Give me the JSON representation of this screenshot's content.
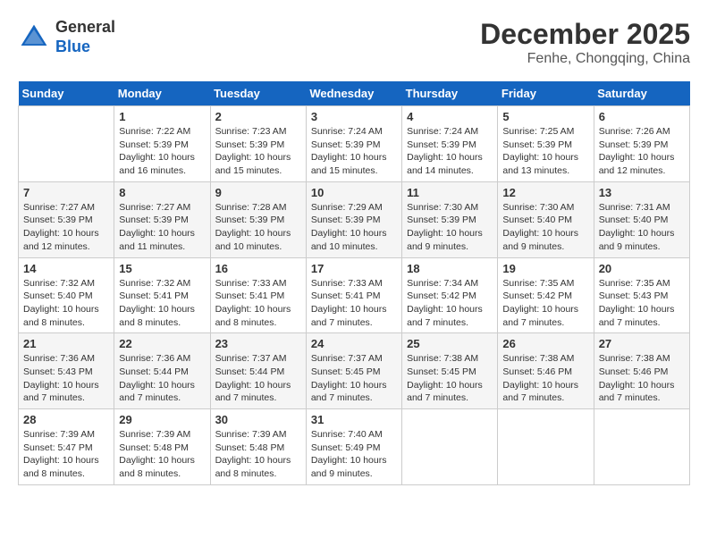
{
  "header": {
    "logo_general": "General",
    "logo_blue": "Blue",
    "month_year": "December 2025",
    "location": "Fenhe, Chongqing, China"
  },
  "days_of_week": [
    "Sunday",
    "Monday",
    "Tuesday",
    "Wednesday",
    "Thursday",
    "Friday",
    "Saturday"
  ],
  "weeks": [
    [
      {
        "day": "",
        "info": ""
      },
      {
        "day": "1",
        "info": "Sunrise: 7:22 AM\nSunset: 5:39 PM\nDaylight: 10 hours\nand 16 minutes."
      },
      {
        "day": "2",
        "info": "Sunrise: 7:23 AM\nSunset: 5:39 PM\nDaylight: 10 hours\nand 15 minutes."
      },
      {
        "day": "3",
        "info": "Sunrise: 7:24 AM\nSunset: 5:39 PM\nDaylight: 10 hours\nand 15 minutes."
      },
      {
        "day": "4",
        "info": "Sunrise: 7:24 AM\nSunset: 5:39 PM\nDaylight: 10 hours\nand 14 minutes."
      },
      {
        "day": "5",
        "info": "Sunrise: 7:25 AM\nSunset: 5:39 PM\nDaylight: 10 hours\nand 13 minutes."
      },
      {
        "day": "6",
        "info": "Sunrise: 7:26 AM\nSunset: 5:39 PM\nDaylight: 10 hours\nand 12 minutes."
      }
    ],
    [
      {
        "day": "7",
        "info": "Sunrise: 7:27 AM\nSunset: 5:39 PM\nDaylight: 10 hours\nand 12 minutes."
      },
      {
        "day": "8",
        "info": "Sunrise: 7:27 AM\nSunset: 5:39 PM\nDaylight: 10 hours\nand 11 minutes."
      },
      {
        "day": "9",
        "info": "Sunrise: 7:28 AM\nSunset: 5:39 PM\nDaylight: 10 hours\nand 10 minutes."
      },
      {
        "day": "10",
        "info": "Sunrise: 7:29 AM\nSunset: 5:39 PM\nDaylight: 10 hours\nand 10 minutes."
      },
      {
        "day": "11",
        "info": "Sunrise: 7:30 AM\nSunset: 5:39 PM\nDaylight: 10 hours\nand 9 minutes."
      },
      {
        "day": "12",
        "info": "Sunrise: 7:30 AM\nSunset: 5:40 PM\nDaylight: 10 hours\nand 9 minutes."
      },
      {
        "day": "13",
        "info": "Sunrise: 7:31 AM\nSunset: 5:40 PM\nDaylight: 10 hours\nand 9 minutes."
      }
    ],
    [
      {
        "day": "14",
        "info": "Sunrise: 7:32 AM\nSunset: 5:40 PM\nDaylight: 10 hours\nand 8 minutes."
      },
      {
        "day": "15",
        "info": "Sunrise: 7:32 AM\nSunset: 5:41 PM\nDaylight: 10 hours\nand 8 minutes."
      },
      {
        "day": "16",
        "info": "Sunrise: 7:33 AM\nSunset: 5:41 PM\nDaylight: 10 hours\nand 8 minutes."
      },
      {
        "day": "17",
        "info": "Sunrise: 7:33 AM\nSunset: 5:41 PM\nDaylight: 10 hours\nand 7 minutes."
      },
      {
        "day": "18",
        "info": "Sunrise: 7:34 AM\nSunset: 5:42 PM\nDaylight: 10 hours\nand 7 minutes."
      },
      {
        "day": "19",
        "info": "Sunrise: 7:35 AM\nSunset: 5:42 PM\nDaylight: 10 hours\nand 7 minutes."
      },
      {
        "day": "20",
        "info": "Sunrise: 7:35 AM\nSunset: 5:43 PM\nDaylight: 10 hours\nand 7 minutes."
      }
    ],
    [
      {
        "day": "21",
        "info": "Sunrise: 7:36 AM\nSunset: 5:43 PM\nDaylight: 10 hours\nand 7 minutes."
      },
      {
        "day": "22",
        "info": "Sunrise: 7:36 AM\nSunset: 5:44 PM\nDaylight: 10 hours\nand 7 minutes."
      },
      {
        "day": "23",
        "info": "Sunrise: 7:37 AM\nSunset: 5:44 PM\nDaylight: 10 hours\nand 7 minutes."
      },
      {
        "day": "24",
        "info": "Sunrise: 7:37 AM\nSunset: 5:45 PM\nDaylight: 10 hours\nand 7 minutes."
      },
      {
        "day": "25",
        "info": "Sunrise: 7:38 AM\nSunset: 5:45 PM\nDaylight: 10 hours\nand 7 minutes."
      },
      {
        "day": "26",
        "info": "Sunrise: 7:38 AM\nSunset: 5:46 PM\nDaylight: 10 hours\nand 7 minutes."
      },
      {
        "day": "27",
        "info": "Sunrise: 7:38 AM\nSunset: 5:46 PM\nDaylight: 10 hours\nand 7 minutes."
      }
    ],
    [
      {
        "day": "28",
        "info": "Sunrise: 7:39 AM\nSunset: 5:47 PM\nDaylight: 10 hours\nand 8 minutes."
      },
      {
        "day": "29",
        "info": "Sunrise: 7:39 AM\nSunset: 5:48 PM\nDaylight: 10 hours\nand 8 minutes."
      },
      {
        "day": "30",
        "info": "Sunrise: 7:39 AM\nSunset: 5:48 PM\nDaylight: 10 hours\nand 8 minutes."
      },
      {
        "day": "31",
        "info": "Sunrise: 7:40 AM\nSunset: 5:49 PM\nDaylight: 10 hours\nand 9 minutes."
      },
      {
        "day": "",
        "info": ""
      },
      {
        "day": "",
        "info": ""
      },
      {
        "day": "",
        "info": ""
      }
    ]
  ]
}
